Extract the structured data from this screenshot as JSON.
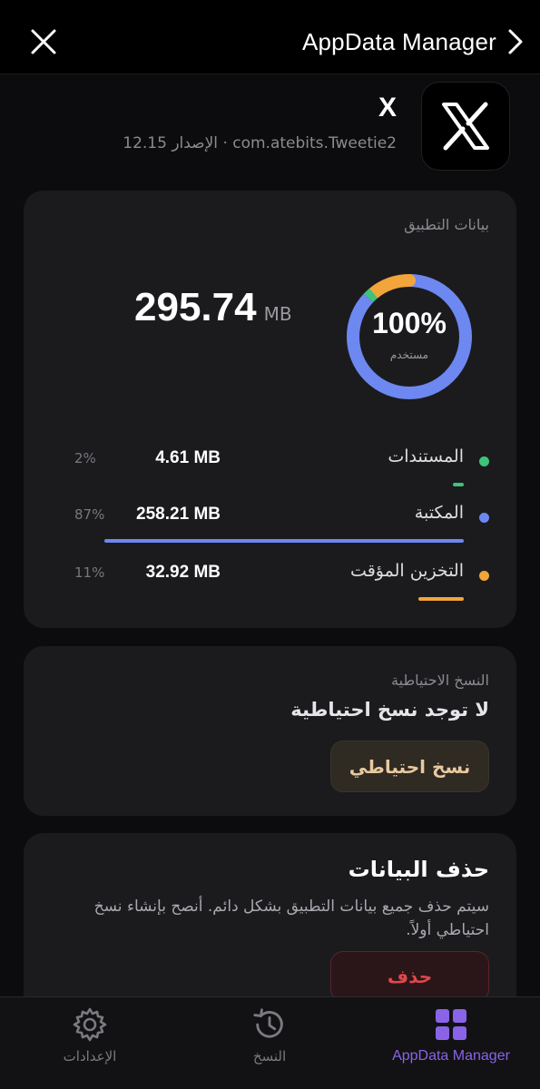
{
  "nav": {
    "title": "AppData Manager",
    "close_icon": "close-icon",
    "forward_icon": "chevron-right-icon"
  },
  "app": {
    "name": "X",
    "meta": "com.atebits.Tweetie2 · الإصدار 12.15",
    "icon": "x-logo-icon"
  },
  "app_data": {
    "label": "بيانات التطبيق",
    "total_value": "295.74",
    "total_unit": "MB",
    "usage_percent_text": "100%",
    "usage_sub": "مستخدم",
    "usage_fraction": 1.0,
    "segments": [
      {
        "label": "المستندات",
        "size": "4.61 MB",
        "percent_text": "2%",
        "fraction": 0.02,
        "color": "#3fc27a"
      },
      {
        "label": "المكتبة",
        "size": "258.21 MB",
        "percent_text": "87%",
        "fraction": 0.87,
        "color": "#6d88f0"
      },
      {
        "label": "التخزين المؤقت",
        "size": "32.92 MB",
        "percent_text": "11%",
        "fraction": 0.11,
        "color": "#f2a53a"
      }
    ]
  },
  "backup": {
    "label": "النسخ الاحتياطية",
    "status": "لا توجد نسخ احتياطية",
    "button": "نسخ احتياطي"
  },
  "delete": {
    "title": "حذف البيانات",
    "description": "سيتم حذف جميع بيانات التطبيق بشكل دائم. أنصح بإنشاء نسخ احتياطي أولاً.",
    "button": "حذف"
  },
  "tabs": [
    {
      "label": "AppData Manager",
      "icon": "grid-icon",
      "active": true
    },
    {
      "label": "النسخ",
      "icon": "history-icon",
      "active": false
    },
    {
      "label": "الإعدادات",
      "icon": "gear-icon",
      "active": false
    }
  ],
  "colors": {
    "accent": "#8a63e8",
    "danger": "#e0474d",
    "backup_text": "#e8c9a0"
  }
}
